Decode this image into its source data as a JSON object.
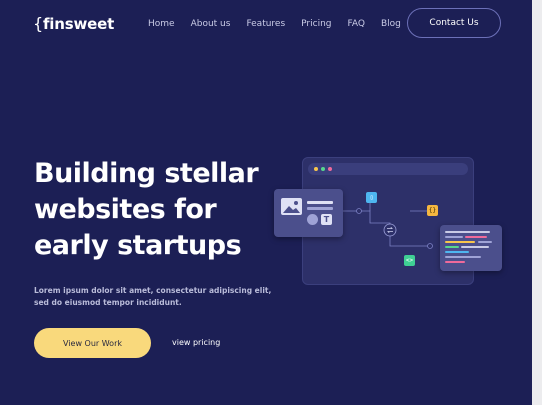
{
  "brand": {
    "logo": "{finsweet",
    "logo_brace": "{",
    "logo_text": "finsweet"
  },
  "nav": {
    "links": [
      "Home",
      "About us",
      "Features",
      "Pricing",
      "FAQ",
      "Blog"
    ],
    "contact_label": "Contact Us"
  },
  "hero": {
    "title_lines": [
      "Building stellar",
      "websites for",
      "early startups"
    ],
    "description_lines": [
      "Lorem ipsum dolor sit amet, consectetur adipiscing elit,",
      "sed do eiusmod tempor incididunt."
    ],
    "primary_label": "View Our Work",
    "secondary_label": "view pricing"
  },
  "colors": {
    "background": "#1c1f55",
    "accent": "#f9d97c",
    "window_dots": [
      "#f8c64d",
      "#58d68d",
      "#ef6a9b"
    ]
  },
  "illustration": {
    "icons": [
      "image-icon",
      "document-icon",
      "code-braces-icon",
      "sync-icon",
      "code-tag-icon",
      "text-icon"
    ]
  }
}
